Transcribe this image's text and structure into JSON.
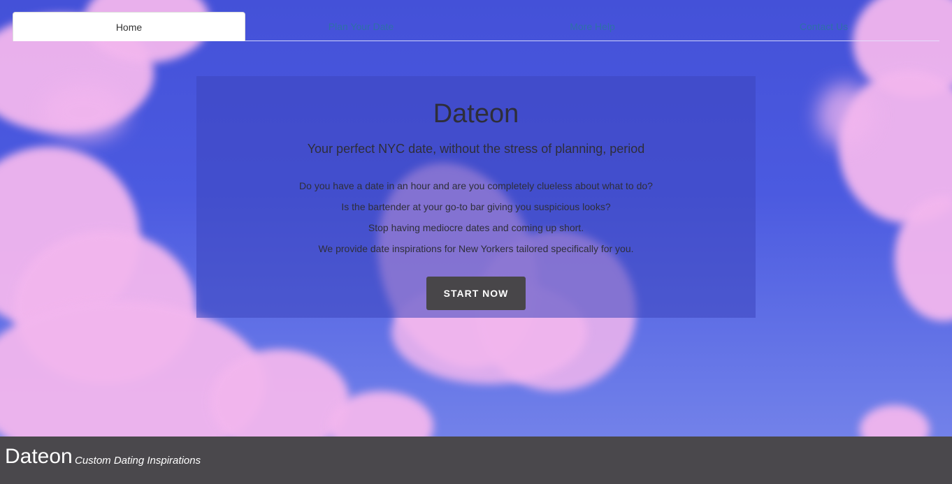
{
  "nav": {
    "tabs": [
      {
        "label": "Home",
        "active": true
      },
      {
        "label": "Plan Your Date",
        "active": false
      },
      {
        "label": "More Help",
        "active": false
      },
      {
        "label": "Contact Us",
        "active": false
      }
    ]
  },
  "hero": {
    "title": "Dateon",
    "subtitle": "Your perfect NYC date, without the stress of planning, period",
    "lines": [
      "Do you have a date in an hour and are you completely clueless about what to do?",
      "Is the bartender at your go-to bar giving you suspicious looks?",
      "Stop having mediocre dates and coming up short.",
      "We provide date inspirations for New Yorkers tailored specifically for you."
    ],
    "cta_label": "START NOW"
  },
  "footer": {
    "brand": "Dateon",
    "tagline": "Custom Dating Inspirations"
  },
  "colors": {
    "sky": "#4451d8",
    "cloud": "#f2b6ee",
    "button": "#484649",
    "footer": "#4a484c",
    "tab_link": "#2f6fa8"
  }
}
